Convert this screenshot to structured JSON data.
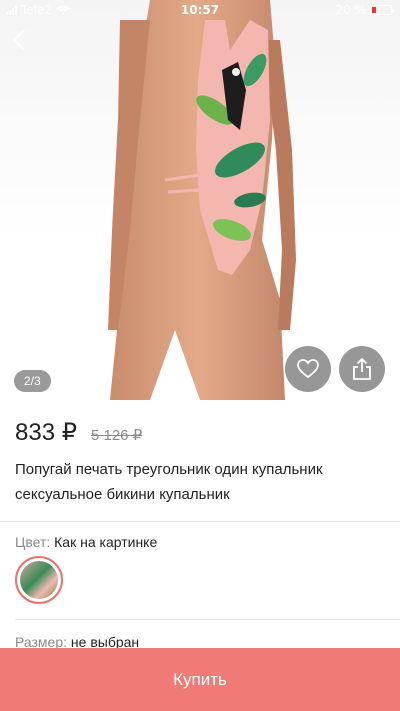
{
  "status_bar": {
    "carrier": "Tele2",
    "time": "10:57",
    "battery": "20 %",
    "battery_level": 0.2
  },
  "gallery": {
    "counter": "2/3"
  },
  "product": {
    "price": "833 ₽",
    "old_price": "5 126 ₽",
    "title": "Попугай печать треугольник один купальник сексуальное бикини купальник"
  },
  "options": {
    "color_label": "Цвет:",
    "color_value": "Как на картинке",
    "size_label": "Размер:",
    "size_value": "не выбран"
  },
  "buy_button": {
    "label": "Купить"
  },
  "colors": {
    "accent": "#f07a75",
    "swatch_border": "#f26d6d"
  }
}
